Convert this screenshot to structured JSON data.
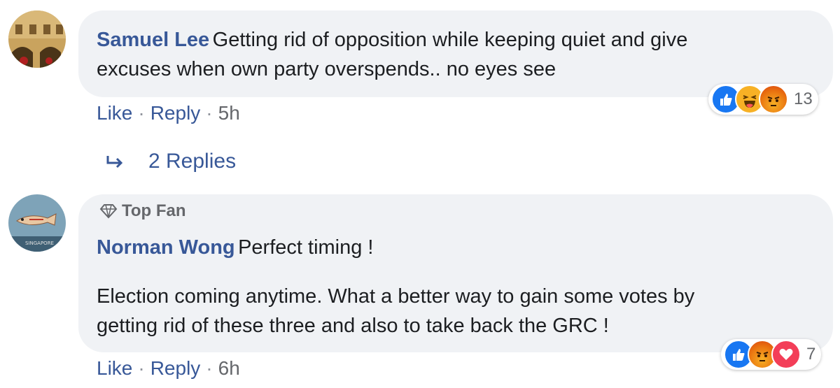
{
  "comments": [
    {
      "author": "Samuel Lee",
      "text_lines": [
        "Getting rid of opposition while keeping quiet and give",
        "excuses when own party overspends.. no eyes see"
      ],
      "reactions": [
        "like",
        "haha",
        "angry"
      ],
      "reaction_count": "13",
      "actions": {
        "like": "Like",
        "reply": "Reply",
        "time": "5h"
      },
      "replies_label": "2 Replies"
    },
    {
      "badge": "Top Fan",
      "author": "Norman Wong",
      "text_first": "Perfect timing !",
      "text_lines": [
        "Election coming anytime. What a better way to gain some votes by",
        "getting rid of these three and also to take back the GRC !"
      ],
      "reactions": [
        "like",
        "angry",
        "love"
      ],
      "reaction_count": "7",
      "actions": {
        "like": "Like",
        "reply": "Reply",
        "time": "6h"
      }
    }
  ],
  "colors": {
    "bubble": "#f0f2f5",
    "link": "#385898",
    "like": "#1877f2",
    "haha": "#f7b125",
    "angry": "#e9710f",
    "love": "#f33e58"
  },
  "avatar_text": "SINGAPORE"
}
